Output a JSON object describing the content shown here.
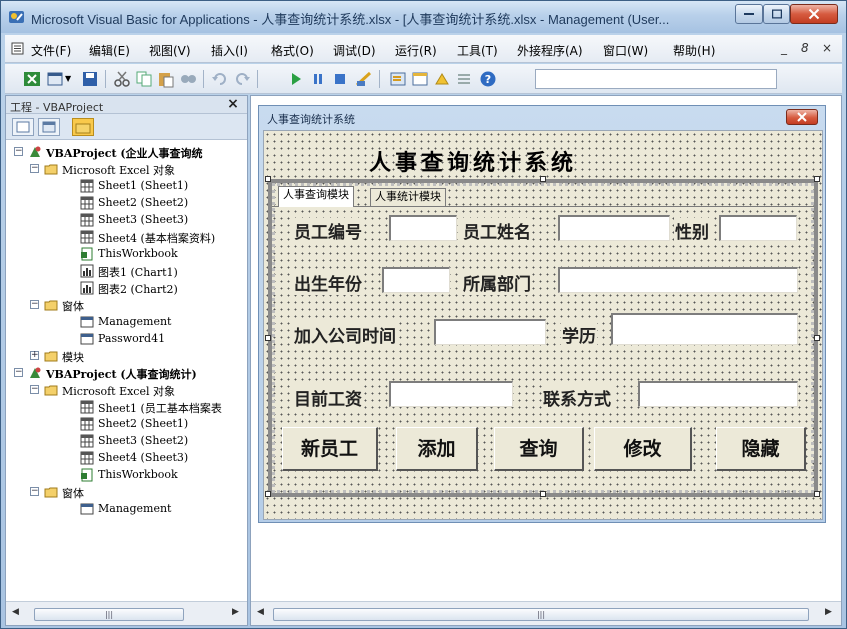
{
  "window": {
    "title": "Microsoft Visual Basic for Applications - 人事查询统计系统.xlsx - [人事查询统计系统.xlsx - Management (User..."
  },
  "menu": {
    "items": [
      "文件(F)",
      "编辑(E)",
      "视图(V)",
      "插入(I)",
      "格式(O)",
      "调试(D)",
      "运行(R)",
      "工具(T)",
      "外接程序(A)",
      "窗口(W)",
      "帮助(H)"
    ],
    "controls": [
      "_",
      "8",
      "×"
    ]
  },
  "project": {
    "title": "工程 - VBAProject",
    "close_label": "×",
    "tree": [
      {
        "label": "VBAProject (企业人事查询统",
        "bold": true,
        "icon": "vba-project-icon"
      },
      {
        "label": "Microsoft Excel 对象",
        "bold": false,
        "icon": "folder-icon"
      },
      {
        "label": "Sheet1 (Sheet1)",
        "bold": false,
        "icon": "sheet-icon"
      },
      {
        "label": "Sheet2 (Sheet2)",
        "bold": false,
        "icon": "sheet-icon"
      },
      {
        "label": "Sheet3 (Sheet3)",
        "bold": false,
        "icon": "sheet-icon"
      },
      {
        "label": "Sheet4 (基本档案资料)",
        "bold": false,
        "icon": "sheet-icon"
      },
      {
        "label": "ThisWorkbook",
        "bold": false,
        "icon": "workbook-icon"
      },
      {
        "label": "图表1 (Chart1)",
        "bold": false,
        "icon": "chart-icon"
      },
      {
        "label": "图表2 (Chart2)",
        "bold": false,
        "icon": "chart-icon"
      },
      {
        "label": "窗体",
        "bold": false,
        "icon": "folder-icon"
      },
      {
        "label": "Management",
        "bold": false,
        "icon": "form-icon"
      },
      {
        "label": "Password41",
        "bold": false,
        "icon": "form-icon"
      },
      {
        "label": "模块",
        "bold": false,
        "icon": "folder-icon"
      },
      {
        "label": "VBAProject (人事查询统计)",
        "bold": true,
        "icon": "vba-project-icon"
      },
      {
        "label": "Microsoft Excel 对象",
        "bold": false,
        "icon": "folder-icon"
      },
      {
        "label": "Sheet1 (员工基本档案表",
        "bold": false,
        "icon": "sheet-icon"
      },
      {
        "label": "Sheet2 (Sheet1)",
        "bold": false,
        "icon": "sheet-icon"
      },
      {
        "label": "Sheet3 (Sheet2)",
        "bold": false,
        "icon": "sheet-icon"
      },
      {
        "label": "Sheet4 (Sheet3)",
        "bold": false,
        "icon": "sheet-icon"
      },
      {
        "label": "ThisWorkbook",
        "bold": false,
        "icon": "workbook-icon"
      },
      {
        "label": "窗体",
        "bold": false,
        "icon": "folder-icon"
      },
      {
        "label": "Management",
        "bold": false,
        "icon": "form-icon"
      }
    ]
  },
  "form": {
    "caption": "人事查询统计系统",
    "title": "人事查询统计系统",
    "tabs": [
      "人事查询模块",
      "人事统计模块"
    ],
    "labels": {
      "emp_no": "员工编号",
      "emp_name": "员工姓名",
      "gender": "性别",
      "birth_year": "出生年份",
      "dept": "所属部门",
      "join_date": "加入公司时间",
      "education": "学历",
      "salary": "目前工资",
      "contact": "联系方式"
    },
    "buttons": {
      "new_employee": "新员工",
      "add": "添加",
      "query": "查询",
      "modify": "修改",
      "hide": "隐藏"
    }
  },
  "colors": {
    "title_bar": "#b8d0ea",
    "form_background": "#ece9d8",
    "close_button": "#d65b40"
  }
}
